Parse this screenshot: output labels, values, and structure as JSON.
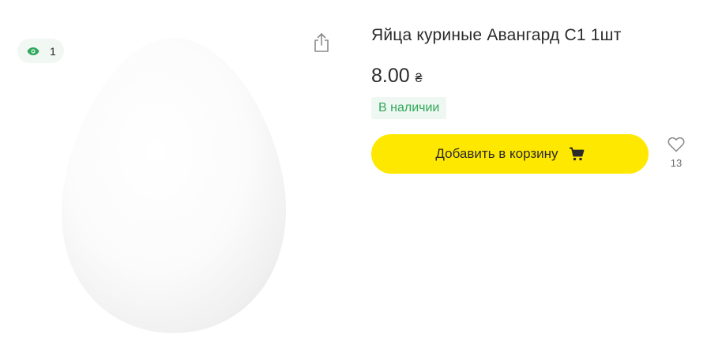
{
  "views": {
    "count": "1",
    "icon": "eye-icon",
    "color": "#2fa85a"
  },
  "share": {
    "icon": "share-icon"
  },
  "product": {
    "image_icon": "egg-image",
    "title": "Яйца куриные Авангард С1 1шт",
    "price": "8.00",
    "currency": "₴",
    "stock_status": "В наличии",
    "stock_color": "#2fa85a"
  },
  "cart_button": {
    "label": "Добавить в корзину",
    "icon": "cart-icon",
    "color": "#ffe800"
  },
  "favorites": {
    "icon": "heart-icon",
    "count": "13"
  }
}
